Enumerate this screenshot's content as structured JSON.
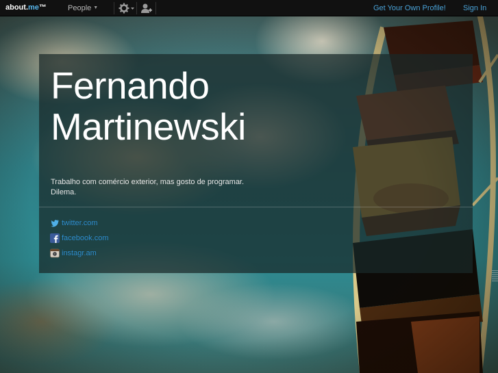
{
  "topbar": {
    "logo_main": "about.",
    "logo_accent": "me",
    "logo_tm": "™",
    "people_label": "People",
    "get_profile_label": "Get Your Own Profile!",
    "sign_in_label": "Sign In"
  },
  "profile": {
    "first_name": "Fernando",
    "last_name": "Martinewski",
    "bio_line1": "Trabalho com comércio exterior, mas gosto de programar.",
    "bio_line2": "Dilema.",
    "links": [
      {
        "label": "twitter.com",
        "icon": "twitter-icon"
      },
      {
        "label": "facebook.com",
        "icon": "facebook-icon"
      },
      {
        "label": "instagr.am",
        "icon": "instagram-icon"
      }
    ]
  },
  "colors": {
    "link": "#2f8fd0",
    "topbar_link": "#4aa3d8",
    "topbar_bg": "#111111",
    "card_bg": "rgba(25,40,40,0.72)"
  }
}
